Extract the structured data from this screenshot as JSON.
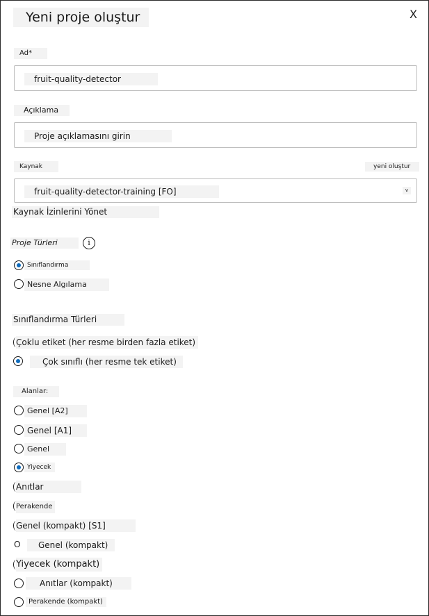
{
  "dialog": {
    "title": "Yeni proje oluştur",
    "close_label": "X"
  },
  "fields": {
    "name_label": "Ad*",
    "name_value": "fruit-quality-detector",
    "description_label": "Açıklama",
    "description_placeholder": "Proje açıklamasını girin",
    "resource_label": "Kaynak",
    "create_new_link": "yeni oluştur",
    "resource_value": "fruit-quality-detector-training [FO]",
    "resource_chevron": "v",
    "manage_permissions_link": "Kaynak İzinlerini Yönet"
  },
  "project_types": {
    "label": "Proje Türleri",
    "info_glyph": "i",
    "options": [
      {
        "label": "Sınıflandırma",
        "selected": true
      },
      {
        "label": "Nesne Algılama",
        "selected": false
      }
    ]
  },
  "classification_types": {
    "label": "Sınıflandırma Türleri",
    "options": [
      {
        "label": "Çoklu etiket (her resme birden fazla etiket)",
        "selected": false
      },
      {
        "label": "Çok sınıflı (her resme tek etiket)",
        "selected": true
      }
    ]
  },
  "domains": {
    "label": "Alanlar:",
    "zero_glyph": "O",
    "options": [
      {
        "label": "Genel [A2]",
        "selected": false
      },
      {
        "label": "Genel [A1]",
        "selected": false
      },
      {
        "label": "Genel",
        "selected": false
      },
      {
        "label": "Yiyecek",
        "selected": true
      },
      {
        "label": "Anıtlar",
        "selected": false
      },
      {
        "label": "Perakende",
        "selected": false
      },
      {
        "label": "Genel (kompakt) [S1]",
        "selected": false
      },
      {
        "label": "Genel (kompakt)",
        "selected": false
      },
      {
        "label": "Yiyecek (kompakt)",
        "selected": false
      },
      {
        "label": "Anıtlar (kompakt)",
        "selected": false
      },
      {
        "label": "Perakende (kompakt)",
        "selected": false
      }
    ]
  },
  "colors": {
    "accent": "#0f6cbd",
    "border": "#2b2b2b",
    "label_background": "#f3f3f3"
  }
}
